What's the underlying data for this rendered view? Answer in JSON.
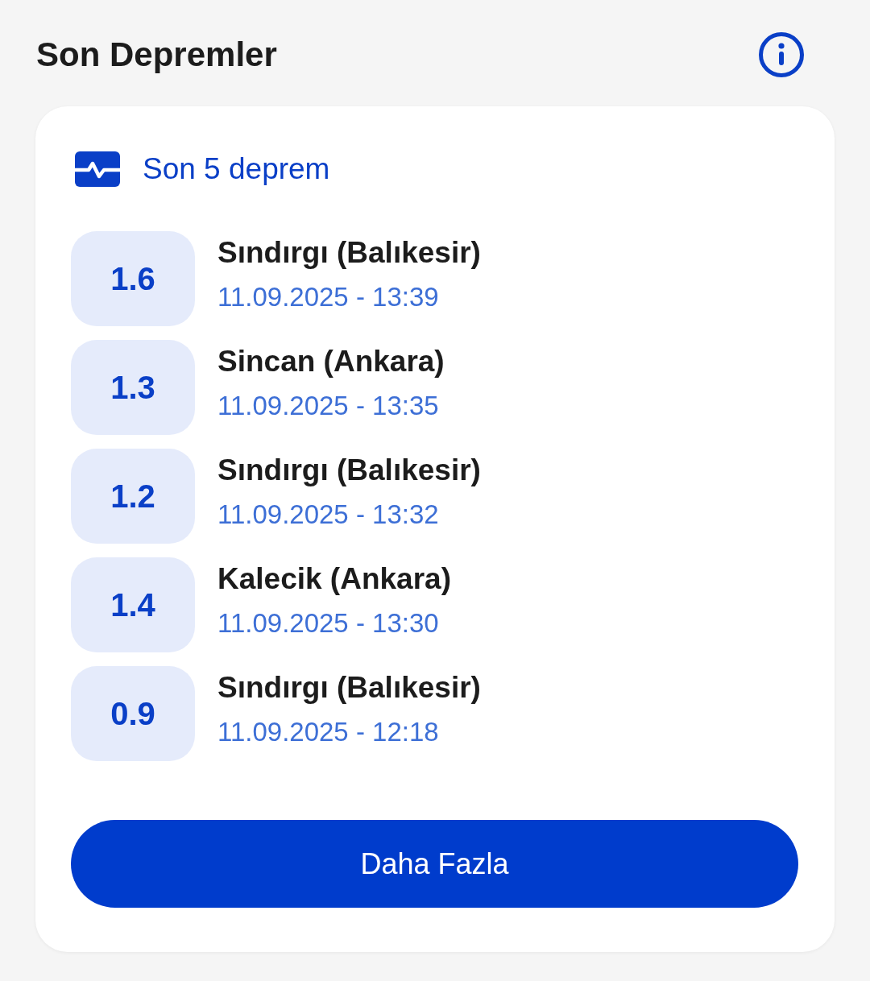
{
  "header": {
    "title": "Son Depremler"
  },
  "card": {
    "heading": "Son 5 deprem",
    "earthquakes": [
      {
        "magnitude": "1.6",
        "location": "Sındırgı (Balıkesir)",
        "datetime": "11.09.2025 - 13:39"
      },
      {
        "magnitude": "1.3",
        "location": "Sincan (Ankara)",
        "datetime": "11.09.2025 - 13:35"
      },
      {
        "magnitude": "1.2",
        "location": "Sındırgı (Balıkesir)",
        "datetime": "11.09.2025 - 13:32"
      },
      {
        "magnitude": "1.4",
        "location": "Kalecik (Ankara)",
        "datetime": "11.09.2025 - 13:30"
      },
      {
        "magnitude": "0.9",
        "location": "Sındırgı (Balıkesir)",
        "datetime": "11.09.2025 - 12:18"
      }
    ],
    "button": "Daha Fazla"
  }
}
